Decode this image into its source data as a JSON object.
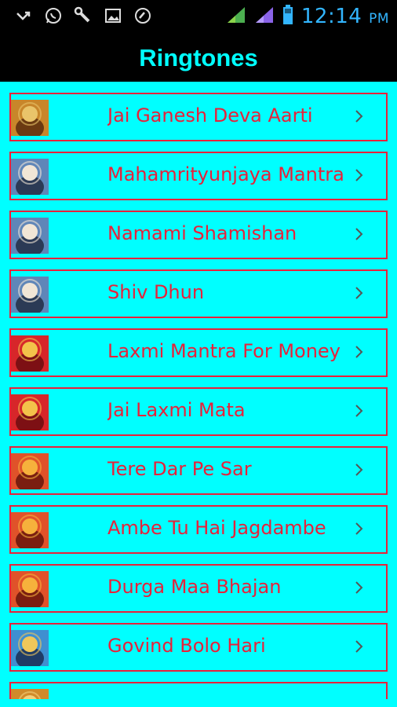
{
  "status_bar": {
    "time": "12:14",
    "ampm": "PM",
    "left_icons": [
      "missed-call-icon",
      "whatsapp-icon",
      "wrench-icon",
      "image-icon",
      "sync-icon"
    ],
    "right_icons": [
      "signal-green-icon",
      "signal-purple-icon",
      "battery-icon"
    ]
  },
  "header": {
    "title": "Ringtones"
  },
  "colors": {
    "bg": "#00ffff",
    "accent": "#e8213a",
    "bar": "#000000",
    "title": "#00ffff"
  },
  "ringtones": [
    {
      "label": "Jai Ganesh Deva Aarti",
      "icon": "ganesh-thumbnail"
    },
    {
      "label": "Mahamrityunjaya Mantra",
      "icon": "shiva-thumbnail"
    },
    {
      "label": "Namami Shamishan",
      "icon": "shiva-thumbnail"
    },
    {
      "label": "Shiv Dhun",
      "icon": "shiva-thumbnail"
    },
    {
      "label": "Laxmi Mantra For Money",
      "icon": "laxmi-thumbnail"
    },
    {
      "label": "Jai Laxmi Mata",
      "icon": "laxmi-thumbnail"
    },
    {
      "label": "Tere Dar Pe Sar",
      "icon": "durga-thumbnail"
    },
    {
      "label": "Ambe Tu Hai Jagdambe",
      "icon": "durga-thumbnail"
    },
    {
      "label": "Durga Maa Bhajan",
      "icon": "durga-thumbnail"
    },
    {
      "label": "Govind Bolo Hari",
      "icon": "krishna-thumbnail"
    },
    {
      "label": "",
      "icon": "deity-thumbnail"
    }
  ]
}
